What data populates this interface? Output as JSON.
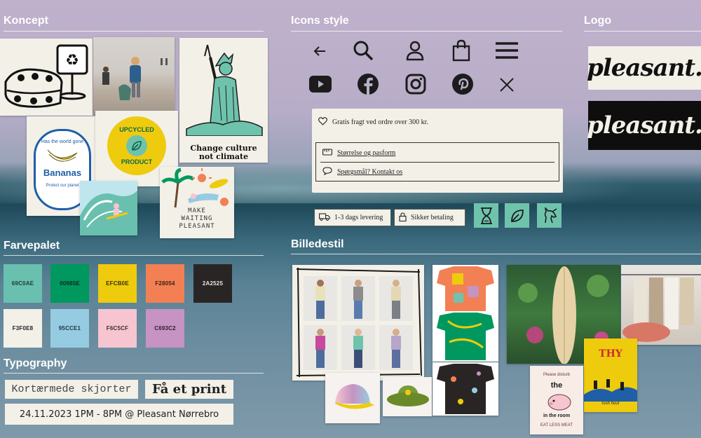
{
  "sections": {
    "koncept": "Koncept",
    "icons": "Icons style",
    "logo": "Logo",
    "farvepalet": "Farvepalet",
    "billedestil": "Billedestil",
    "typography": "Typography"
  },
  "concept": {
    "bananas_top": "Has the world gone",
    "bananas_word": "Bananas",
    "bananas_bottom": "Protect our planet",
    "upcycled_top": "UPCYCLED",
    "upcycled_bottom": "PRODUCT",
    "liberty_line1": "Change culture",
    "liberty_line2": "not climate",
    "make_line1": "MAKE",
    "make_line2": "WAITING",
    "make_line3": "PLEASANT"
  },
  "palette": [
    {
      "hex": "69C0AE",
      "color": "#69C0AE",
      "text": "#1f3a34"
    },
    {
      "hex": "00985E",
      "color": "#00985E",
      "text": "#0b2a1c"
    },
    {
      "hex": "EFCB0E",
      "color": "#EFCB0E",
      "text": "#3a3205"
    },
    {
      "hex": "F28054",
      "color": "#F28054",
      "text": "#3a1e12"
    },
    {
      "hex": "2A2525",
      "color": "#2A2525",
      "text": "#e9e4e4"
    },
    {
      "hex": "F3F0E8",
      "color": "#F3F0E8",
      "text": "#222222"
    },
    {
      "hex": "95CCE1",
      "color": "#95CCE1",
      "text": "#1d3540"
    },
    {
      "hex": "F6C5CF",
      "color": "#F6C5CF",
      "text": "#3c2a2e"
    },
    {
      "hex": "C693C2",
      "color": "#C693C2",
      "text": "#2f1d2e"
    }
  ],
  "typography": {
    "sample1": "Kortærmede skjorter",
    "sample2": "Få et print",
    "sample3": "24.11.2023 1PM - 8PM @ Pleasant Nørrebro"
  },
  "icons_row1": [
    "arrow-left-icon",
    "search-icon",
    "user-icon",
    "shopping-bag-icon",
    "menu-icon"
  ],
  "icons_row2": [
    "youtube-icon",
    "facebook-icon",
    "instagram-icon",
    "pinterest-icon",
    "close-icon"
  ],
  "info_panel": {
    "shipping": "Gratis fragt ved ordre over 300 kr.",
    "size_guide": "Størrelse og pasform",
    "contact": "Spørgsmål? Kontakt os"
  },
  "badges": {
    "delivery": "1-3 dags levering",
    "payment": "Sikker betaling"
  },
  "tile_icons": [
    "hourglass-icon",
    "leaf-icon",
    "unicorn-icon"
  ],
  "logo": {
    "light": "pleasant.",
    "dark": "pleasant."
  },
  "billedestil": {
    "poster_title": "THY",
    "poster_sub": "rush hour",
    "sticker_line1": "Please disturb",
    "sticker_line2": "the",
    "sticker_line3": "in the room",
    "sticker_line4": "EAT LESS MEAT"
  }
}
